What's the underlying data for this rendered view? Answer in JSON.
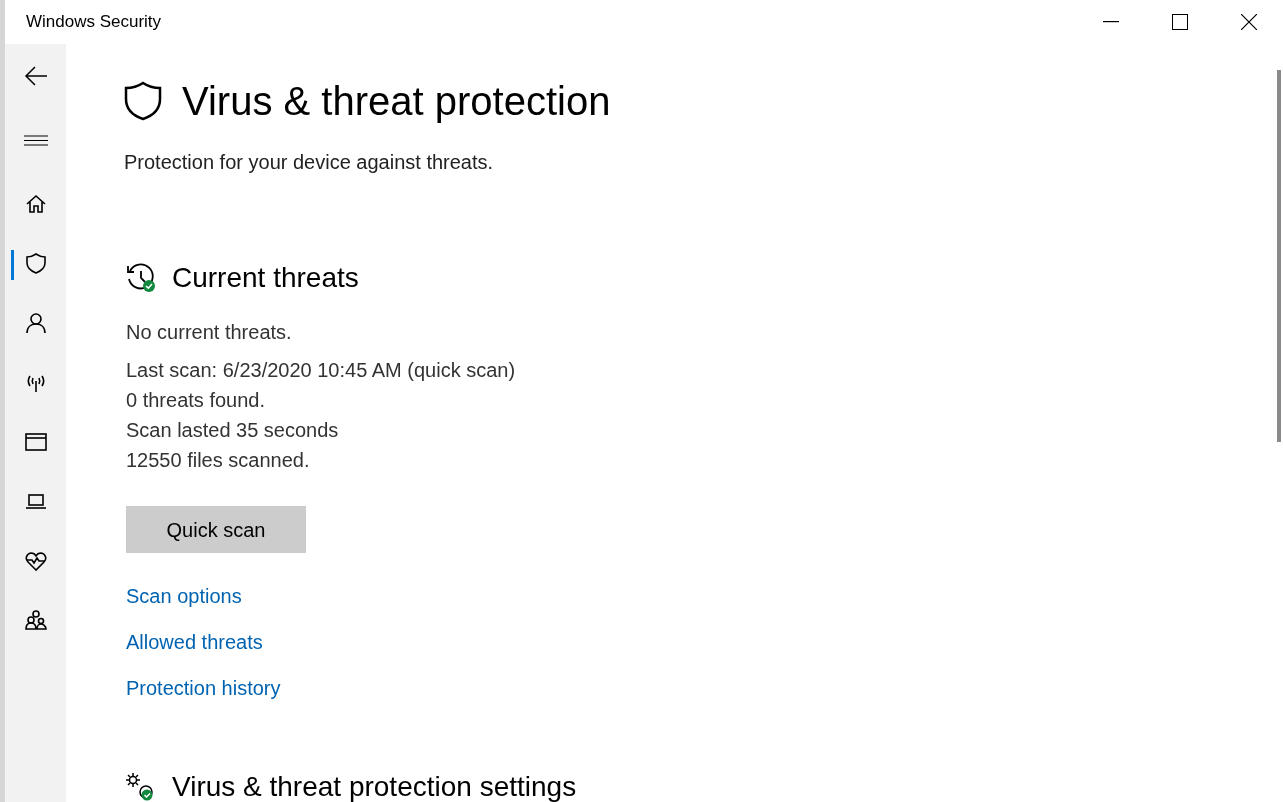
{
  "window": {
    "title": "Windows Security"
  },
  "sidebar": {
    "items": [
      {
        "kind": "home",
        "selected": false
      },
      {
        "kind": "shield",
        "selected": true
      },
      {
        "kind": "person",
        "selected": false
      },
      {
        "kind": "antenna",
        "selected": false
      },
      {
        "kind": "window",
        "selected": false
      },
      {
        "kind": "laptop",
        "selected": false
      },
      {
        "kind": "heart",
        "selected": false
      },
      {
        "kind": "family",
        "selected": false
      }
    ]
  },
  "page": {
    "title": "Virus & threat protection",
    "subtitle": "Protection for your device against threats."
  },
  "current_threats": {
    "heading": "Current threats",
    "status": "No current threats.",
    "details": [
      "Last scan: 6/23/2020 10:45 AM (quick scan)",
      "0 threats found.",
      "Scan lasted 35 seconds",
      "12550 files scanned."
    ],
    "button": "Quick scan",
    "links": [
      "Scan options",
      "Allowed threats",
      "Protection history"
    ]
  },
  "settings": {
    "heading": "Virus & threat protection settings"
  }
}
